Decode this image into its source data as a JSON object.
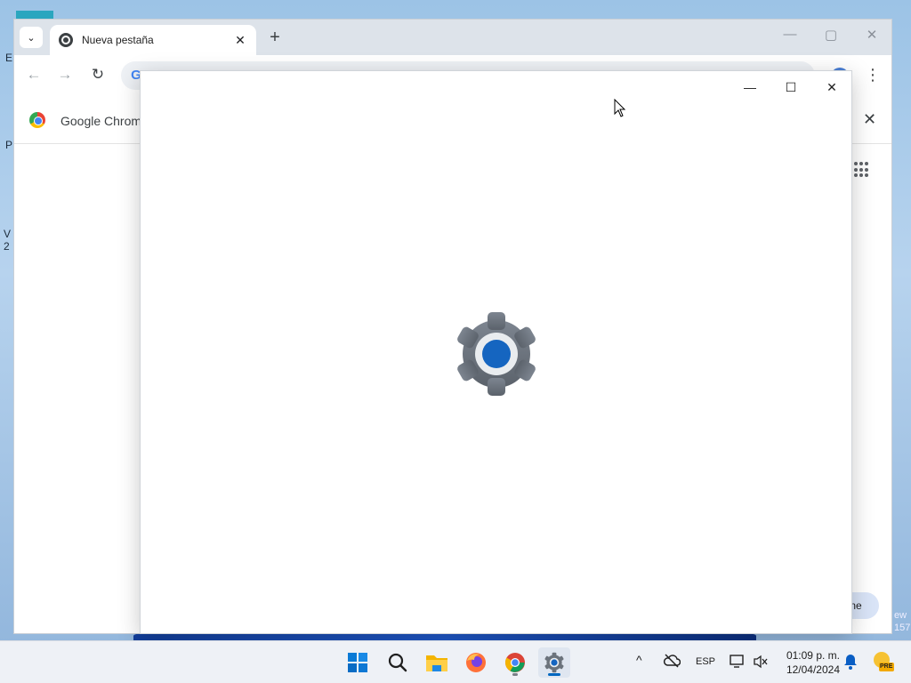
{
  "desktop": {
    "fragments": [
      "E",
      "P",
      "V",
      "2",
      "ew",
      "157"
    ]
  },
  "chrome": {
    "tab": {
      "title": "Nueva pestaña",
      "close_glyph": "✕"
    },
    "tab_search_glyph": "⌄",
    "new_tab_glyph": "+",
    "window_controls": {
      "minimize": "—",
      "maximize": "▢",
      "close": "✕"
    },
    "toolbar": {
      "back": "←",
      "forward": "→",
      "reload": "↻",
      "omnibox_logo": "G",
      "menu": "⋮"
    },
    "infobar": {
      "text": "Google Chrome",
      "close_glyph": "✕"
    },
    "customize_label": "ne"
  },
  "settings_window": {
    "controls": {
      "minimize": "—",
      "maximize": "☐",
      "close": "✕"
    },
    "icon": "gear-icon",
    "accent": "#1565c0"
  },
  "taskbar": {
    "apps": [
      {
        "name": "start-button",
        "icon": "windows-logo-icon"
      },
      {
        "name": "search-button",
        "icon": "search-icon"
      },
      {
        "name": "file-explorer",
        "icon": "folder-icon"
      },
      {
        "name": "firefox",
        "icon": "firefox-icon"
      },
      {
        "name": "chrome",
        "icon": "chrome-icon"
      },
      {
        "name": "settings",
        "icon": "gear-icon"
      }
    ],
    "tray": {
      "chevron": "^",
      "language": "ESP"
    },
    "clock": {
      "time": "01:09 p. m.",
      "date": "12/04/2024"
    },
    "badge": "PRE"
  }
}
